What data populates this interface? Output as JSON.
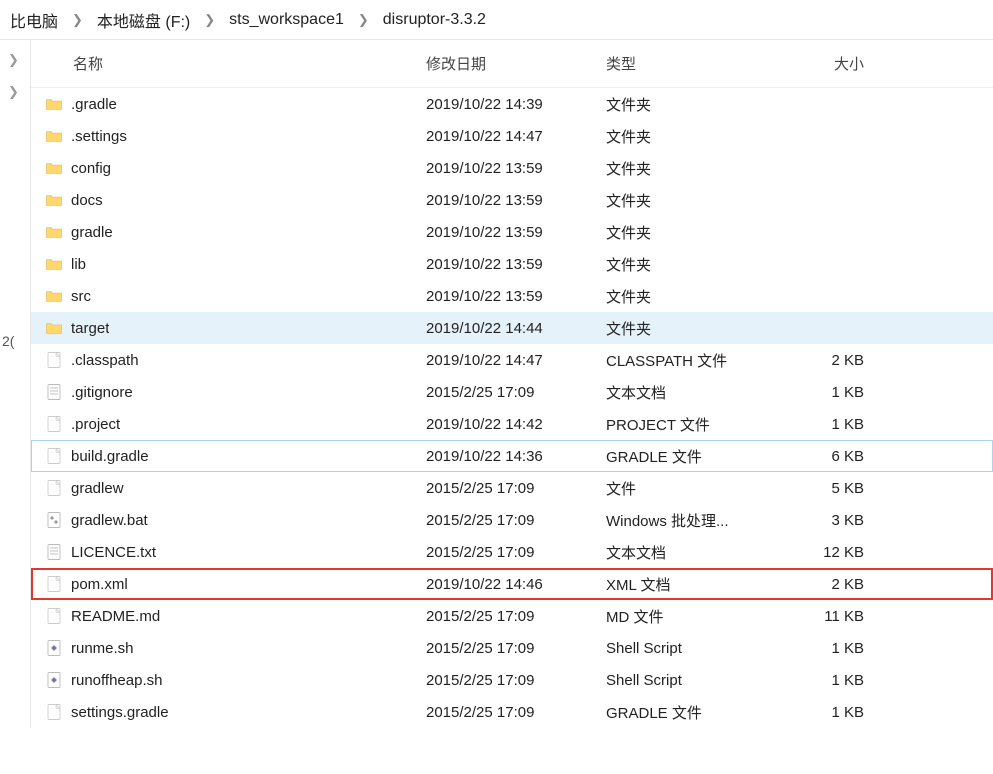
{
  "breadcrumb": {
    "parts": [
      "比电脑",
      "本地磁盘 (F:)",
      "sts_workspace1",
      "disruptor-3.3.2"
    ]
  },
  "left_marker": "2(",
  "columns": {
    "name": "名称",
    "date": "修改日期",
    "type": "类型",
    "size": "大小"
  },
  "rows": [
    {
      "icon": "folder",
      "name": ".gradle",
      "date": "2019/10/22 14:39",
      "type": "文件夹",
      "size": "",
      "selected": false,
      "focused": false,
      "highlighted": false
    },
    {
      "icon": "folder",
      "name": ".settings",
      "date": "2019/10/22 14:47",
      "type": "文件夹",
      "size": "",
      "selected": false,
      "focused": false,
      "highlighted": false
    },
    {
      "icon": "folder",
      "name": "config",
      "date": "2019/10/22 13:59",
      "type": "文件夹",
      "size": "",
      "selected": false,
      "focused": false,
      "highlighted": false
    },
    {
      "icon": "folder",
      "name": "docs",
      "date": "2019/10/22 13:59",
      "type": "文件夹",
      "size": "",
      "selected": false,
      "focused": false,
      "highlighted": false
    },
    {
      "icon": "folder",
      "name": "gradle",
      "date": "2019/10/22 13:59",
      "type": "文件夹",
      "size": "",
      "selected": false,
      "focused": false,
      "highlighted": false
    },
    {
      "icon": "folder",
      "name": "lib",
      "date": "2019/10/22 13:59",
      "type": "文件夹",
      "size": "",
      "selected": false,
      "focused": false,
      "highlighted": false
    },
    {
      "icon": "folder",
      "name": "src",
      "date": "2019/10/22 13:59",
      "type": "文件夹",
      "size": "",
      "selected": false,
      "focused": false,
      "highlighted": false
    },
    {
      "icon": "folder",
      "name": "target",
      "date": "2019/10/22 14:44",
      "type": "文件夹",
      "size": "",
      "selected": true,
      "focused": false,
      "highlighted": false
    },
    {
      "icon": "blank",
      "name": ".classpath",
      "date": "2019/10/22 14:47",
      "type": "CLASSPATH 文件",
      "size": "2 KB",
      "selected": false,
      "focused": false,
      "highlighted": false
    },
    {
      "icon": "text",
      "name": ".gitignore",
      "date": "2015/2/25 17:09",
      "type": "文本文档",
      "size": "1 KB",
      "selected": false,
      "focused": false,
      "highlighted": false
    },
    {
      "icon": "blank",
      "name": ".project",
      "date": "2019/10/22 14:42",
      "type": "PROJECT 文件",
      "size": "1 KB",
      "selected": false,
      "focused": false,
      "highlighted": false
    },
    {
      "icon": "blank",
      "name": "build.gradle",
      "date": "2019/10/22 14:36",
      "type": "GRADLE 文件",
      "size": "6 KB",
      "selected": false,
      "focused": true,
      "highlighted": false
    },
    {
      "icon": "blank",
      "name": "gradlew",
      "date": "2015/2/25 17:09",
      "type": "文件",
      "size": "5 KB",
      "selected": false,
      "focused": false,
      "highlighted": false
    },
    {
      "icon": "bat",
      "name": "gradlew.bat",
      "date": "2015/2/25 17:09",
      "type": "Windows 批处理...",
      "size": "3 KB",
      "selected": false,
      "focused": false,
      "highlighted": false
    },
    {
      "icon": "text",
      "name": "LICENCE.txt",
      "date": "2015/2/25 17:09",
      "type": "文本文档",
      "size": "12 KB",
      "selected": false,
      "focused": false,
      "highlighted": false
    },
    {
      "icon": "blank",
      "name": "pom.xml",
      "date": "2019/10/22 14:46",
      "type": "XML 文档",
      "size": "2 KB",
      "selected": false,
      "focused": false,
      "highlighted": true
    },
    {
      "icon": "blank",
      "name": "README.md",
      "date": "2015/2/25 17:09",
      "type": "MD 文件",
      "size": "11 KB",
      "selected": false,
      "focused": false,
      "highlighted": false
    },
    {
      "icon": "sh",
      "name": "runme.sh",
      "date": "2015/2/25 17:09",
      "type": "Shell Script",
      "size": "1 KB",
      "selected": false,
      "focused": false,
      "highlighted": false
    },
    {
      "icon": "sh",
      "name": "runoffheap.sh",
      "date": "2015/2/25 17:09",
      "type": "Shell Script",
      "size": "1 KB",
      "selected": false,
      "focused": false,
      "highlighted": false
    },
    {
      "icon": "blank",
      "name": "settings.gradle",
      "date": "2015/2/25 17:09",
      "type": "GRADLE 文件",
      "size": "1 KB",
      "selected": false,
      "focused": false,
      "highlighted": false
    }
  ]
}
